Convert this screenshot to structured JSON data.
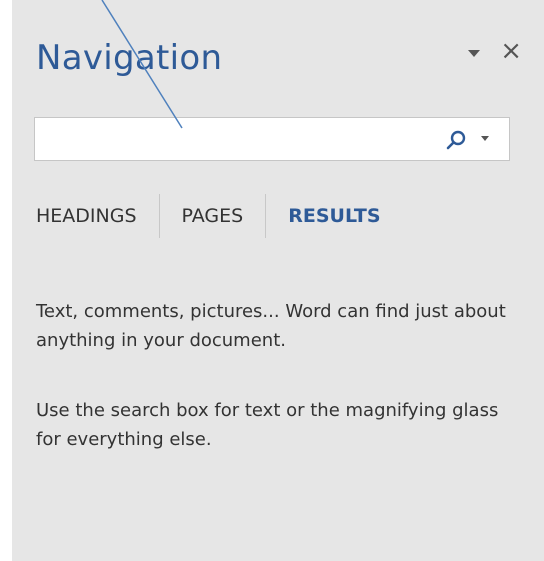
{
  "pane": {
    "title": "Navigation",
    "menu_icon": "dropdown-triangle",
    "close_label": "×"
  },
  "search": {
    "value": "",
    "placeholder": "",
    "icon": "magnifying-glass",
    "dropdown_icon": "small-triangle-down"
  },
  "tabs": [
    {
      "label": "HEADINGS",
      "active": false
    },
    {
      "label": "PAGES",
      "active": false
    },
    {
      "label": "RESULTS",
      "active": true
    }
  ],
  "results": {
    "hint_1": "Text, comments, pictures... Word can find just about anything in your document.",
    "hint_2": "Use the search box for text or the magnifying glass for everything else."
  },
  "colors": {
    "accent": "#2e5a97",
    "pane_background": "#e6e6e6",
    "annotation_line": "#4f81bd"
  }
}
